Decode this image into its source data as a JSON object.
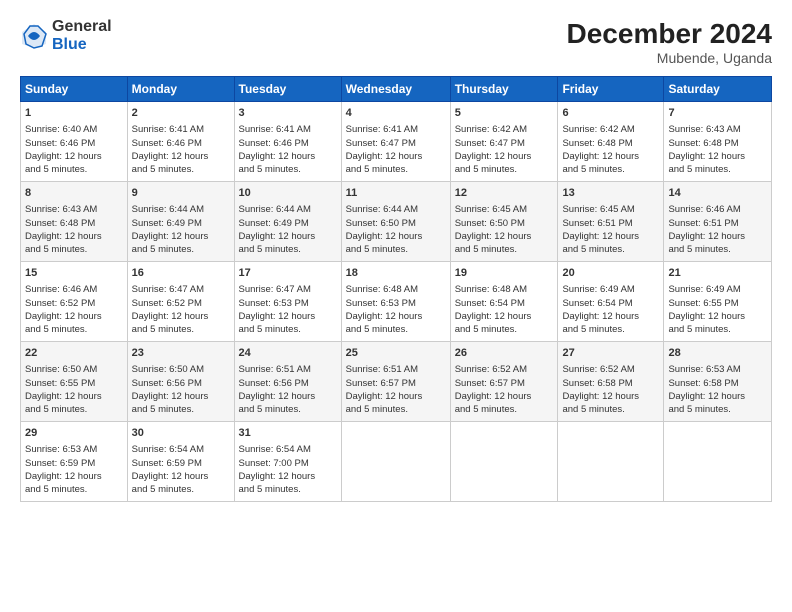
{
  "logo": {
    "general": "General",
    "blue": "Blue"
  },
  "title": "December 2024",
  "subtitle": "Mubende, Uganda",
  "headers": [
    "Sunday",
    "Monday",
    "Tuesday",
    "Wednesday",
    "Thursday",
    "Friday",
    "Saturday"
  ],
  "weeks": [
    [
      {
        "day": "1",
        "lines": [
          "Sunrise: 6:40 AM",
          "Sunset: 6:46 PM",
          "Daylight: 12 hours",
          "and 5 minutes."
        ]
      },
      {
        "day": "2",
        "lines": [
          "Sunrise: 6:41 AM",
          "Sunset: 6:46 PM",
          "Daylight: 12 hours",
          "and 5 minutes."
        ]
      },
      {
        "day": "3",
        "lines": [
          "Sunrise: 6:41 AM",
          "Sunset: 6:46 PM",
          "Daylight: 12 hours",
          "and 5 minutes."
        ]
      },
      {
        "day": "4",
        "lines": [
          "Sunrise: 6:41 AM",
          "Sunset: 6:47 PM",
          "Daylight: 12 hours",
          "and 5 minutes."
        ]
      },
      {
        "day": "5",
        "lines": [
          "Sunrise: 6:42 AM",
          "Sunset: 6:47 PM",
          "Daylight: 12 hours",
          "and 5 minutes."
        ]
      },
      {
        "day": "6",
        "lines": [
          "Sunrise: 6:42 AM",
          "Sunset: 6:48 PM",
          "Daylight: 12 hours",
          "and 5 minutes."
        ]
      },
      {
        "day": "7",
        "lines": [
          "Sunrise: 6:43 AM",
          "Sunset: 6:48 PM",
          "Daylight: 12 hours",
          "and 5 minutes."
        ]
      }
    ],
    [
      {
        "day": "8",
        "lines": [
          "Sunrise: 6:43 AM",
          "Sunset: 6:48 PM",
          "Daylight: 12 hours",
          "and 5 minutes."
        ]
      },
      {
        "day": "9",
        "lines": [
          "Sunrise: 6:44 AM",
          "Sunset: 6:49 PM",
          "Daylight: 12 hours",
          "and 5 minutes."
        ]
      },
      {
        "day": "10",
        "lines": [
          "Sunrise: 6:44 AM",
          "Sunset: 6:49 PM",
          "Daylight: 12 hours",
          "and 5 minutes."
        ]
      },
      {
        "day": "11",
        "lines": [
          "Sunrise: 6:44 AM",
          "Sunset: 6:50 PM",
          "Daylight: 12 hours",
          "and 5 minutes."
        ]
      },
      {
        "day": "12",
        "lines": [
          "Sunrise: 6:45 AM",
          "Sunset: 6:50 PM",
          "Daylight: 12 hours",
          "and 5 minutes."
        ]
      },
      {
        "day": "13",
        "lines": [
          "Sunrise: 6:45 AM",
          "Sunset: 6:51 PM",
          "Daylight: 12 hours",
          "and 5 minutes."
        ]
      },
      {
        "day": "14",
        "lines": [
          "Sunrise: 6:46 AM",
          "Sunset: 6:51 PM",
          "Daylight: 12 hours",
          "and 5 minutes."
        ]
      }
    ],
    [
      {
        "day": "15",
        "lines": [
          "Sunrise: 6:46 AM",
          "Sunset: 6:52 PM",
          "Daylight: 12 hours",
          "and 5 minutes."
        ]
      },
      {
        "day": "16",
        "lines": [
          "Sunrise: 6:47 AM",
          "Sunset: 6:52 PM",
          "Daylight: 12 hours",
          "and 5 minutes."
        ]
      },
      {
        "day": "17",
        "lines": [
          "Sunrise: 6:47 AM",
          "Sunset: 6:53 PM",
          "Daylight: 12 hours",
          "and 5 minutes."
        ]
      },
      {
        "day": "18",
        "lines": [
          "Sunrise: 6:48 AM",
          "Sunset: 6:53 PM",
          "Daylight: 12 hours",
          "and 5 minutes."
        ]
      },
      {
        "day": "19",
        "lines": [
          "Sunrise: 6:48 AM",
          "Sunset: 6:54 PM",
          "Daylight: 12 hours",
          "and 5 minutes."
        ]
      },
      {
        "day": "20",
        "lines": [
          "Sunrise: 6:49 AM",
          "Sunset: 6:54 PM",
          "Daylight: 12 hours",
          "and 5 minutes."
        ]
      },
      {
        "day": "21",
        "lines": [
          "Sunrise: 6:49 AM",
          "Sunset: 6:55 PM",
          "Daylight: 12 hours",
          "and 5 minutes."
        ]
      }
    ],
    [
      {
        "day": "22",
        "lines": [
          "Sunrise: 6:50 AM",
          "Sunset: 6:55 PM",
          "Daylight: 12 hours",
          "and 5 minutes."
        ]
      },
      {
        "day": "23",
        "lines": [
          "Sunrise: 6:50 AM",
          "Sunset: 6:56 PM",
          "Daylight: 12 hours",
          "and 5 minutes."
        ]
      },
      {
        "day": "24",
        "lines": [
          "Sunrise: 6:51 AM",
          "Sunset: 6:56 PM",
          "Daylight: 12 hours",
          "and 5 minutes."
        ]
      },
      {
        "day": "25",
        "lines": [
          "Sunrise: 6:51 AM",
          "Sunset: 6:57 PM",
          "Daylight: 12 hours",
          "and 5 minutes."
        ]
      },
      {
        "day": "26",
        "lines": [
          "Sunrise: 6:52 AM",
          "Sunset: 6:57 PM",
          "Daylight: 12 hours",
          "and 5 minutes."
        ]
      },
      {
        "day": "27",
        "lines": [
          "Sunrise: 6:52 AM",
          "Sunset: 6:58 PM",
          "Daylight: 12 hours",
          "and 5 minutes."
        ]
      },
      {
        "day": "28",
        "lines": [
          "Sunrise: 6:53 AM",
          "Sunset: 6:58 PM",
          "Daylight: 12 hours",
          "and 5 minutes."
        ]
      }
    ],
    [
      {
        "day": "29",
        "lines": [
          "Sunrise: 6:53 AM",
          "Sunset: 6:59 PM",
          "Daylight: 12 hours",
          "and 5 minutes."
        ]
      },
      {
        "day": "30",
        "lines": [
          "Sunrise: 6:54 AM",
          "Sunset: 6:59 PM",
          "Daylight: 12 hours",
          "and 5 minutes."
        ]
      },
      {
        "day": "31",
        "lines": [
          "Sunrise: 6:54 AM",
          "Sunset: 7:00 PM",
          "Daylight: 12 hours",
          "and 5 minutes."
        ]
      },
      null,
      null,
      null,
      null
    ]
  ]
}
